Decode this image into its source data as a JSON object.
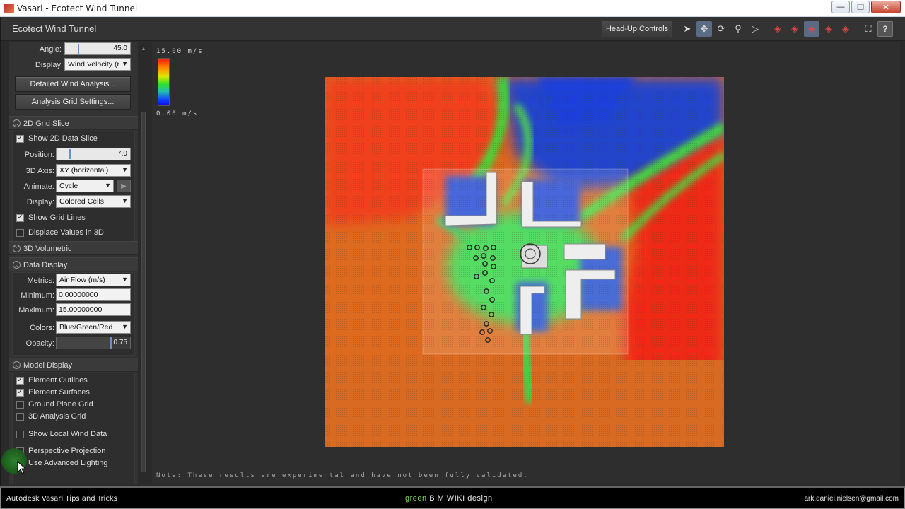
{
  "window": {
    "title": "Vasari - Ecotect Wind Tunnel",
    "controls": {
      "minimize": "—",
      "maximize": "❐",
      "close": "✕"
    }
  },
  "header": {
    "title": "Ecotect Wind Tunnel",
    "hud_button": "Head-Up Controls",
    "tools": [
      {
        "name": "select-arrow-icon",
        "glyph": "➤"
      },
      {
        "name": "pan-icon",
        "glyph": "✥"
      },
      {
        "name": "orbit-icon",
        "glyph": "⟳"
      },
      {
        "name": "zoom-icon",
        "glyph": "⚲"
      },
      {
        "name": "walk-icon",
        "glyph": "▷"
      },
      {
        "name": "view-cube-icon-1",
        "glyph": "◈"
      },
      {
        "name": "view-cube-icon-2",
        "glyph": "◈"
      },
      {
        "name": "view-cube-icon-3",
        "glyph": "◈"
      },
      {
        "name": "view-cube-icon-4",
        "glyph": "◈"
      },
      {
        "name": "view-cube-icon-5",
        "glyph": "◈"
      },
      {
        "name": "fit-view-icon",
        "glyph": "⛶"
      },
      {
        "name": "help-icon",
        "glyph": "?"
      }
    ]
  },
  "panel": {
    "angle": {
      "label": "Angle:",
      "value": "45.0"
    },
    "display_top": {
      "label": "Display:",
      "value": "Wind Velocity (r"
    },
    "detailed_button": "Detailed Wind Analysis...",
    "grid_settings_button": "Analysis Grid Settings...",
    "grid_slice": {
      "title": "2D Grid Slice",
      "show_slice": "Show 2D Data Slice",
      "position": {
        "label": "Position:",
        "value": "7.0"
      },
      "axis": {
        "label": "3D Axis:",
        "value": "XY (horizontal)"
      },
      "animate": {
        "label": "Animate:",
        "value": "Cycle"
      },
      "display": {
        "label": "Display:",
        "value": "Colored Cells"
      },
      "show_grid_lines": "Show Grid Lines",
      "displace": "Displace Values in 3D"
    },
    "volumetric": {
      "title": "3D Volumetric"
    },
    "data_display": {
      "title": "Data Display",
      "metrics": {
        "label": "Metrics:",
        "value": "Air Flow (m/s)"
      },
      "minimum": {
        "label": "Minimum:",
        "value": "0.00000000"
      },
      "maximum": {
        "label": "Maximum:",
        "value": "15.00000000"
      },
      "colors": {
        "label": "Colors:",
        "value": "Blue/Green/Red"
      },
      "opacity": {
        "label": "Opacity:",
        "value": "0.75",
        "level": 0.75
      }
    },
    "model_display": {
      "title": "Model Display",
      "element_outlines": "Element Outlines",
      "element_surfaces": "Element Surfaces",
      "ground_plane_grid": "Ground Plane Grid",
      "analysis_grid": "3D Analysis Grid",
      "local_wind": "Show Local Wind Data",
      "perspective": "Perspective Projection",
      "advanced_lighting": "Use Advanced Lighting"
    }
  },
  "viewport": {
    "legend_max": "15.00 m/s",
    "legend_min": "0.00 m/s",
    "note": "Note: These results are experimental and have not been fully validated."
  },
  "footer": {
    "left": "Autodesk Vasari Tips and Tricks",
    "center_green": "green",
    "center_mid": " BIM WIKI ",
    "center_end": "design",
    "right": "ark.daniel.nielsen@gmail.com"
  },
  "colors": {
    "low": "#1030e0",
    "mid": "#30e030",
    "high": "#ff2a0a",
    "ambient": "#e06a20"
  }
}
